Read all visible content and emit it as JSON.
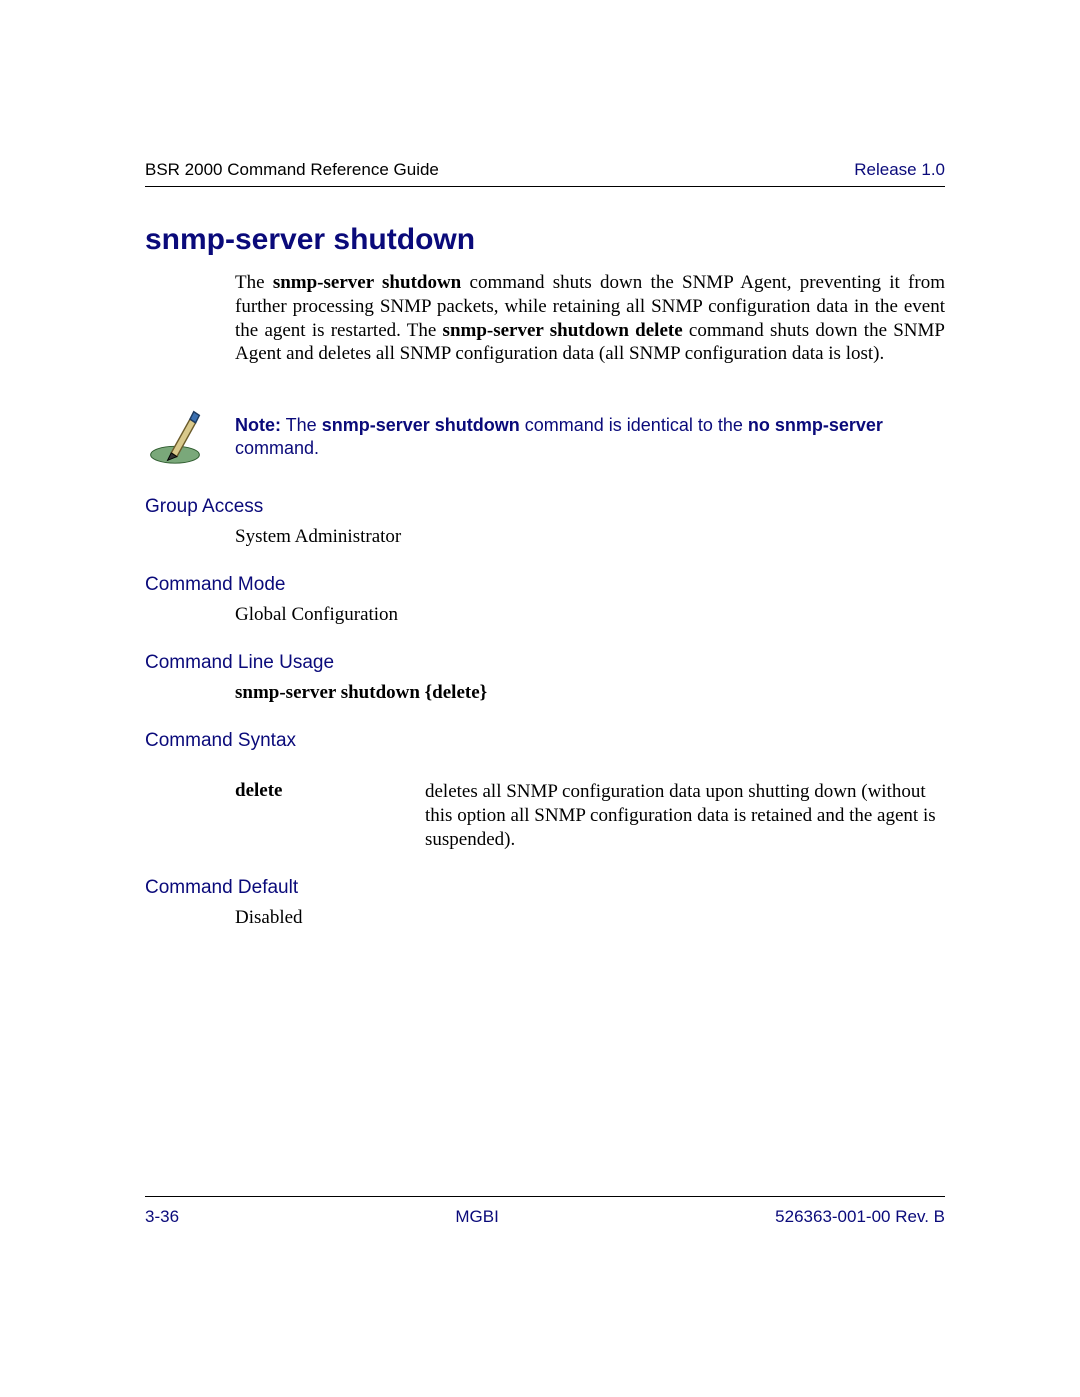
{
  "header": {
    "left": "BSR 2000 Command Reference Guide",
    "right": "Release 1.0"
  },
  "title": "snmp-server shutdown",
  "intro": {
    "p1a": "The ",
    "p1b": "snmp-server shutdown",
    "p1c": " command shuts down the SNMP Agent, preventing it from further processing SNMP packets, while retaining all SNMP configuration data in the event the agent is restarted. The ",
    "p1d": "snmp-server shutdown delete",
    "p1e": " command shuts down the SNMP Agent and deletes all SNMP configuration data (all SNMP configuration data is lost)."
  },
  "note": {
    "a": "Note:",
    "b": " The ",
    "c": "snmp-server shutdown",
    "d": " command is identical to the ",
    "e": "no snmp-server",
    "f": " command."
  },
  "sections": {
    "group_access_label": "Group Access",
    "group_access_value": "System Administrator",
    "command_mode_label": "Command Mode",
    "command_mode_value": "Global Configuration",
    "usage_label": "Command Line Usage",
    "usage_value": "snmp-server shutdown {delete}",
    "syntax_label": "Command Syntax",
    "syntax_key": "delete",
    "syntax_desc": "deletes all SNMP configuration data upon shutting down (without this option all SNMP configuration data is retained and the agent is suspended).",
    "default_label": "Command Default",
    "default_value": "Disabled"
  },
  "footer": {
    "left": "3-36",
    "center": "MGBI",
    "right": "526363-001-00 Rev. B"
  }
}
